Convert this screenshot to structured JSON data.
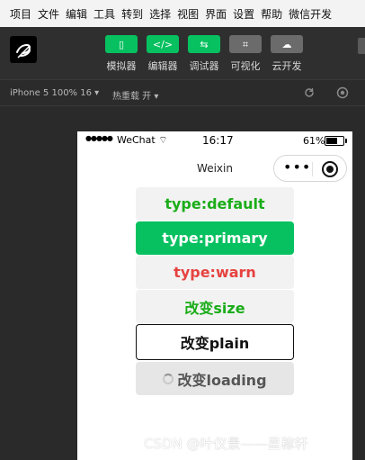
{
  "menubar": {
    "items": [
      "项目",
      "文件",
      "编辑",
      "工具",
      "转到",
      "选择",
      "视图",
      "界面",
      "设置",
      "帮助",
      "微信开发"
    ]
  },
  "toolbar": {
    "tools": [
      {
        "label": "模拟器",
        "icon": "phone-icon",
        "glyph": "▯"
      },
      {
        "label": "编辑器",
        "icon": "code-icon",
        "glyph": "</>"
      },
      {
        "label": "调试器",
        "icon": "debug-icon",
        "glyph": "⇆"
      },
      {
        "label": "可视化",
        "icon": "layout-icon",
        "glyph": "⌗"
      },
      {
        "label": "云开发",
        "icon": "cloud-icon",
        "glyph": "☁"
      }
    ],
    "colors": {
      "active": "#07c160",
      "inactive": "#6b6b6b"
    }
  },
  "sim": {
    "device": "iPhone 5 100% 16 ▾",
    "hot_reload": "热重载 开 ▾",
    "refresh_icon": "refresh-icon",
    "stop_icon": "stop-icon"
  },
  "phone": {
    "status": {
      "signal": "●●●●●",
      "carrier": "WeChat",
      "wifi": "⌔",
      "time": "16:17",
      "battery": "61%"
    },
    "nav": {
      "title": "Weixin"
    },
    "buttons": [
      {
        "text": "type:default"
      },
      {
        "text": "type:primary"
      },
      {
        "text": "type:warn"
      },
      {
        "text": "改变size"
      },
      {
        "text": "改变plain"
      },
      {
        "text": "改变loading"
      }
    ]
  },
  "watermark": "CSDN @叶仪景——星稼轩"
}
